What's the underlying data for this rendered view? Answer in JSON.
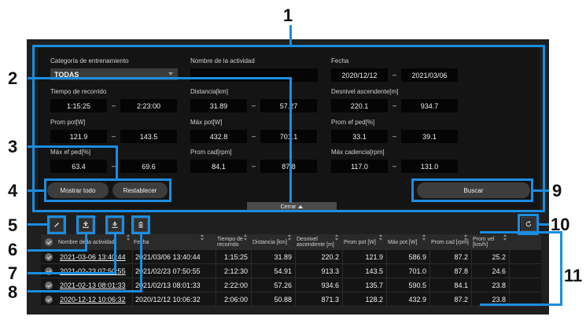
{
  "filters": {
    "category_label": "Categoría de entrenamiento",
    "category_value": "TODAS",
    "activity_name_label": "Nombre de la actividad",
    "activity_name_value": "",
    "date_label": "Fecha",
    "date_from": "2020/12/12",
    "date_to": "2021/03/06",
    "time_label": "Tiempo de recorrido",
    "time_from": "1:15:25",
    "time_to": "2:23:00",
    "distance_label": "Distancia[km]",
    "distance_from": "31.89",
    "distance_to": "57.27",
    "ascent_label": "Desnivel ascendente[m]",
    "ascent_from": "220.1",
    "ascent_to": "934.7",
    "avg_pow_label": "Prom pot[W]",
    "avg_pow_from": "121.9",
    "avg_pow_to": "143.5",
    "max_pow_label": "Máx pot[W]",
    "max_pow_from": "432.8",
    "max_pow_to": "701.1",
    "avg_eff_label": "Prom ef ped[%]",
    "avg_eff_from": "33.1",
    "avg_eff_to": "39.1",
    "max_eff_label": "Máx ef ped[%]",
    "max_eff_from": "63.4",
    "max_eff_to": "69.6",
    "avg_cad_label": "Prom cad[rpm]",
    "avg_cad_from": "84.1",
    "avg_cad_to": "87.8",
    "max_cad_label": "Máx cadencia[rpm]",
    "max_cad_from": "117.0",
    "max_cad_to": "131.0",
    "dash": "–"
  },
  "buttons": {
    "show_all": "Mostrar todo",
    "reset": "Restablecer",
    "search": "Buscar",
    "close": "Cerrar"
  },
  "toolbar_icons": [
    "pencil-icon",
    "upload-icon",
    "download-icon",
    "trash-icon",
    "refresh-icon"
  ],
  "table": {
    "columns": [
      "Nombre de la actividad",
      "Fecha",
      "Tiempo de recorrido",
      "Distancia [km]",
      "Desnivel ascendente [m]",
      "Prom pot [W]",
      "Máx pot [W]",
      "Prom cad [rpm]",
      "Prom vel [km/h]"
    ],
    "rows": [
      [
        "2021-03-06 13:40:44",
        "2021/03/06 13:40:44",
        "1:15:25",
        "31.89",
        "220.2",
        "121.9",
        "586.9",
        "87.2",
        "25.2"
      ],
      [
        "2021-02-23 07:50:55",
        "2021/02/23 07:50:55",
        "2:12:30",
        "54.91",
        "913.3",
        "143.5",
        "701.0",
        "87.8",
        "24.6"
      ],
      [
        "2021-02-13 08:01:33",
        "2021/02/13 08:01:33",
        "2:22:00",
        "57.26",
        "934.6",
        "135.7",
        "590.5",
        "84.1",
        "23.8"
      ],
      [
        "2020-12-12 10:06:32",
        "2020/12/12 10:06:32",
        "2:06:00",
        "50.88",
        "871.3",
        "128.2",
        "432.9",
        "87.2",
        "23.8"
      ]
    ]
  },
  "callouts": [
    "1",
    "2",
    "3",
    "4",
    "5",
    "6",
    "7",
    "8",
    "9",
    "10",
    "11"
  ],
  "colors": {
    "callout_blue": "#1b8de0",
    "background": "#141414",
    "panel": "#1f1f1f"
  }
}
